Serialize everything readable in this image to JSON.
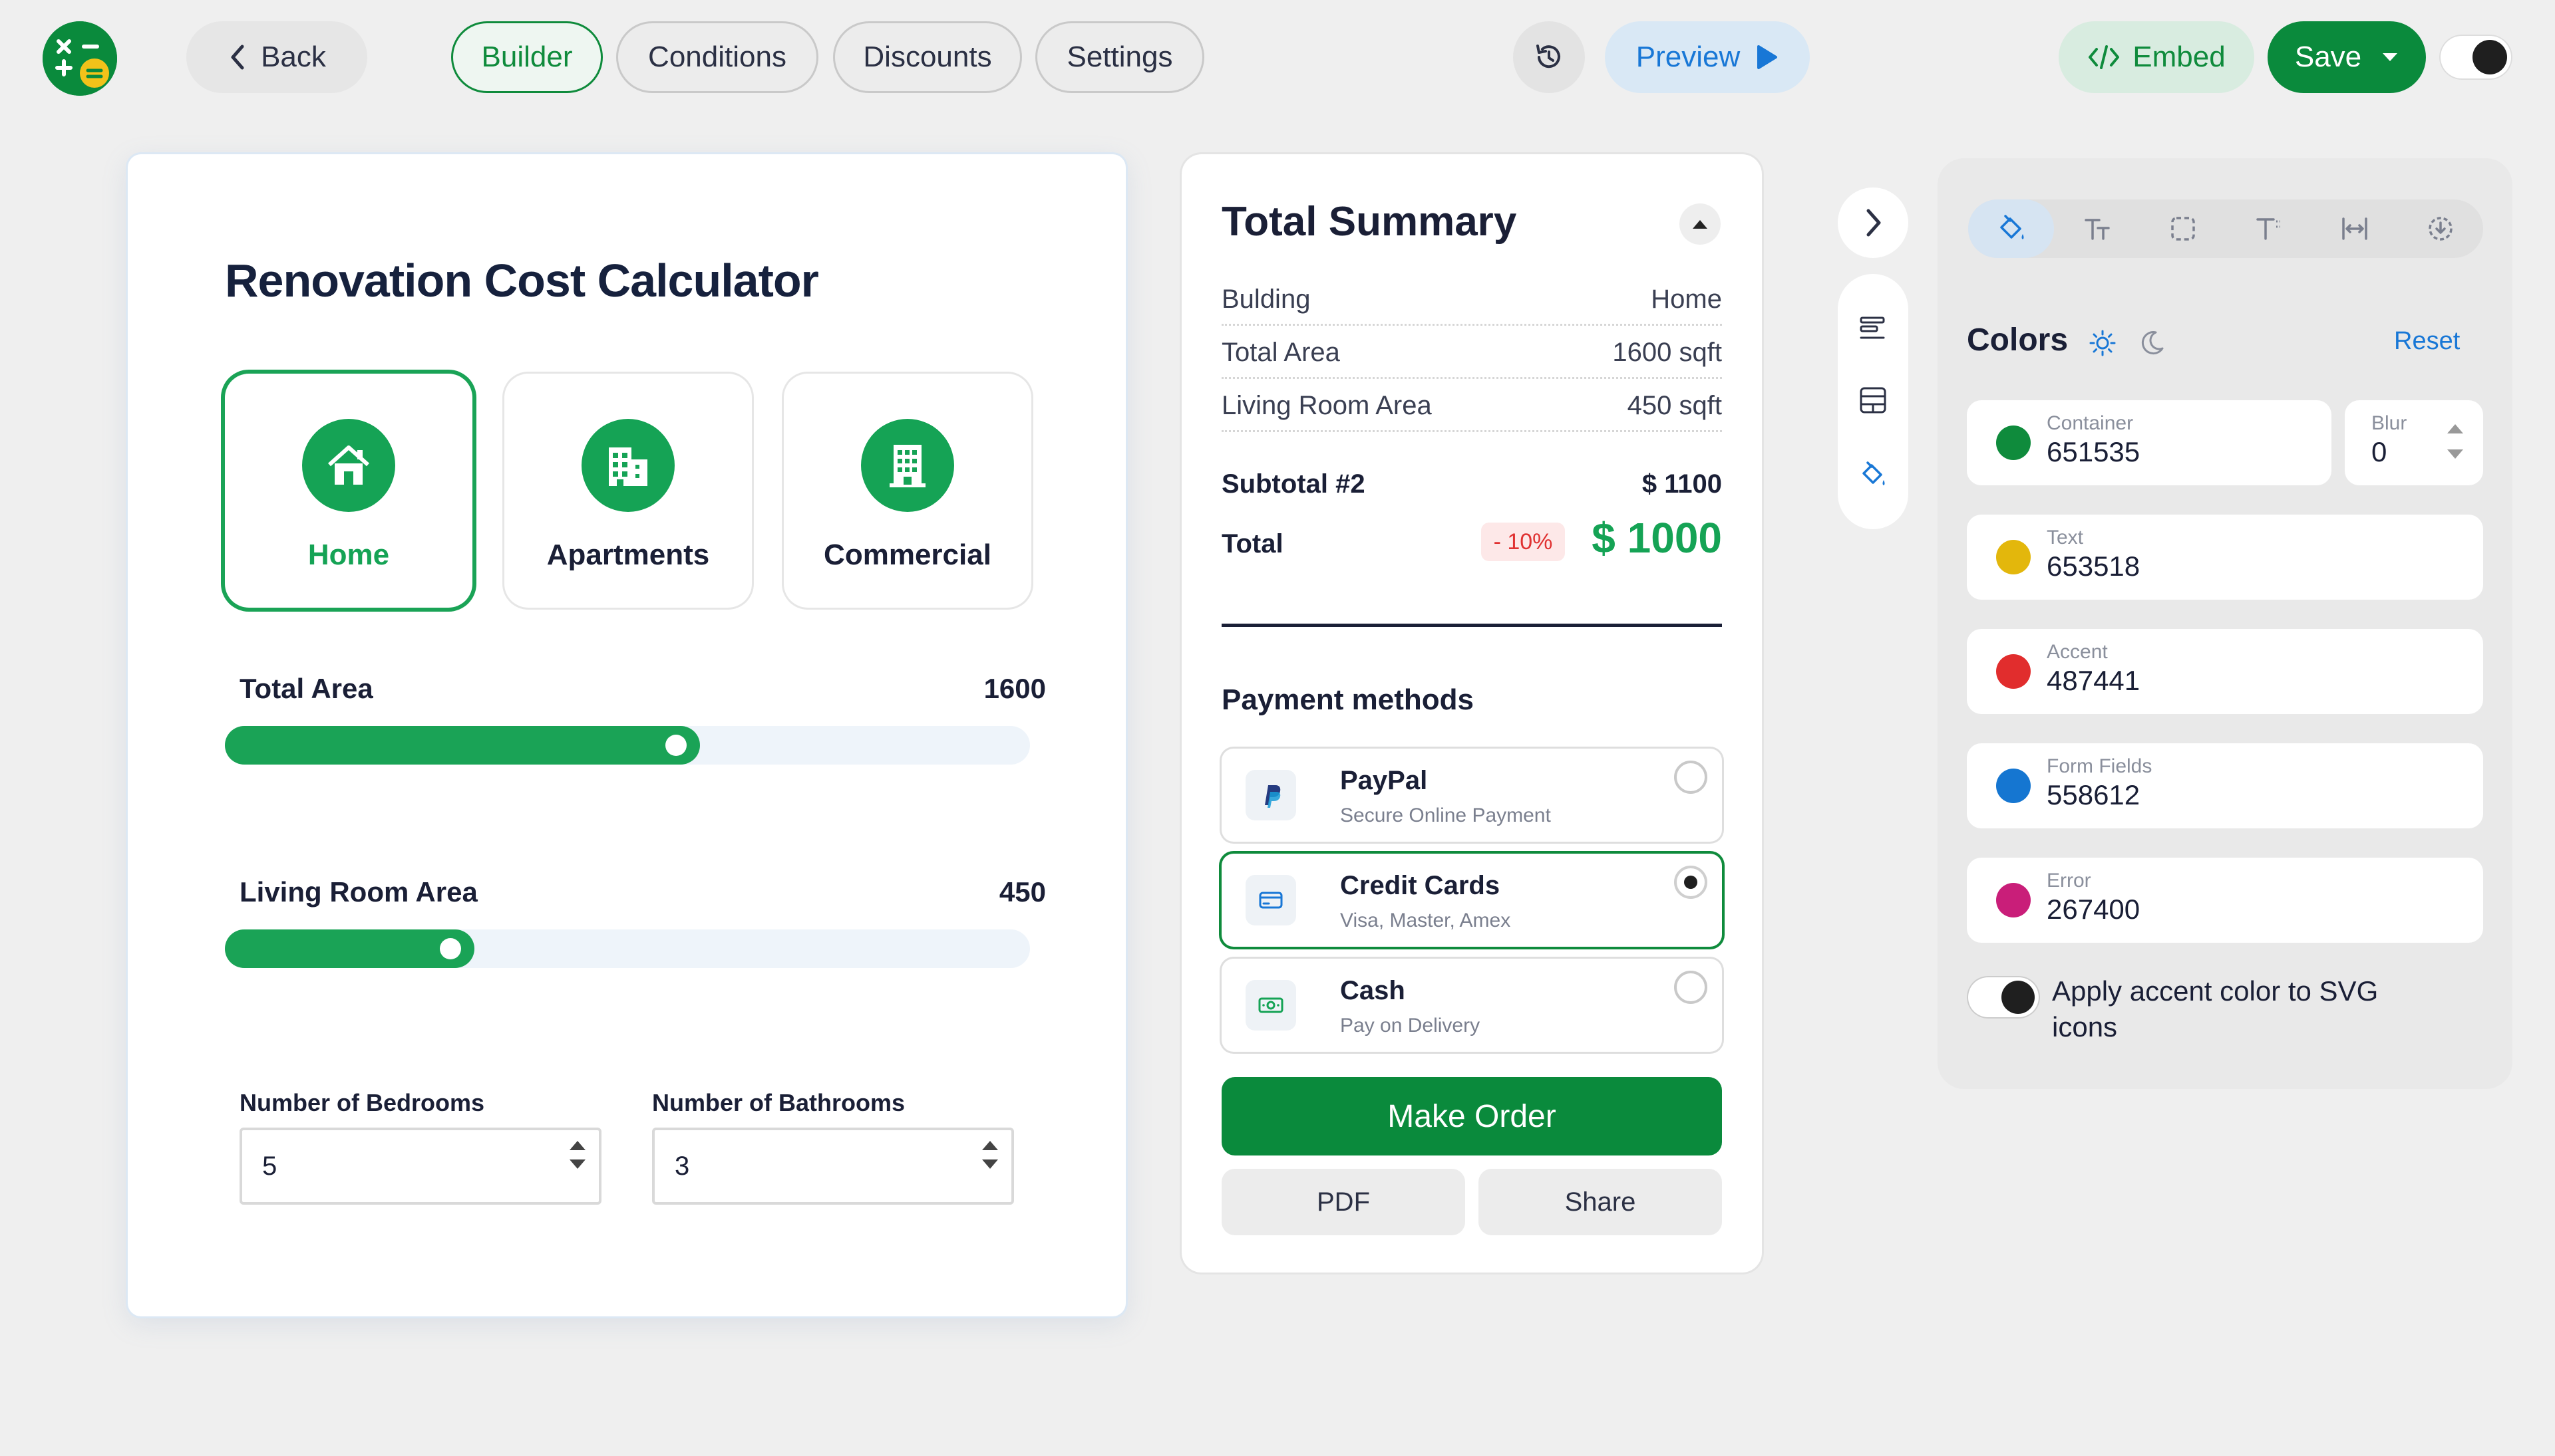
{
  "topbar": {
    "back_label": "Back",
    "tabs": [
      {
        "label": "Builder",
        "active": true
      },
      {
        "label": "Conditions",
        "active": false
      },
      {
        "label": "Discounts",
        "active": false
      },
      {
        "label": "Settings",
        "active": false
      }
    ],
    "preview_label": "Preview",
    "embed_label": "Embed",
    "save_label": "Save",
    "dark_mode": true
  },
  "calculator": {
    "title": "Renovation Cost Calculator",
    "building_types": [
      {
        "label": "Home",
        "icon": "home-icon",
        "selected": true
      },
      {
        "label": "Apartments",
        "icon": "apartments-icon",
        "selected": false
      },
      {
        "label": "Commercial",
        "icon": "commercial-icon",
        "selected": false
      }
    ],
    "sliders": [
      {
        "label": "Total Area",
        "value": "1600",
        "fill": 0.59
      },
      {
        "label": "Living Room Area",
        "value": "450",
        "fill": 0.31
      }
    ],
    "inputs": [
      {
        "label": "Number of Bedrooms",
        "value": "5"
      },
      {
        "label": "Number of Bathrooms",
        "value": "3"
      }
    ]
  },
  "summary": {
    "title": "Total Summary",
    "rows": [
      {
        "label": "Bulding",
        "value": "Home"
      },
      {
        "label": "Total Area",
        "value": "1600 sqft"
      },
      {
        "label": "Living Room Area",
        "value": "450 sqft"
      }
    ],
    "subtotal_label": "Subtotal #2",
    "subtotal_value": "$ 1100",
    "total_label": "Total",
    "discount": "- 10%",
    "total_value": "$ 1000",
    "payment_title": "Payment methods",
    "payment_methods": [
      {
        "name": "PayPal",
        "sub": "Secure Online Payment",
        "icon": "paypal-icon",
        "selected": false
      },
      {
        "name": "Credit Cards",
        "sub": "Visa, Master, Amex",
        "icon": "credit-card-icon",
        "selected": true
      },
      {
        "name": "Cash",
        "sub": "Pay on Delivery",
        "icon": "cash-icon",
        "selected": false
      }
    ],
    "order_label": "Make Order",
    "pdf_label": "PDF",
    "share_label": "Share"
  },
  "style_panel": {
    "section_title": "Colors",
    "reset_label": "Reset",
    "blur_label": "Blur",
    "blur_value": "0",
    "colors": [
      {
        "label": "Container",
        "value": "651535",
        "swatch": "#0f8b3c"
      },
      {
        "label": "Text",
        "value": "653518",
        "swatch": "#e3b70c"
      },
      {
        "label": "Accent",
        "value": "487441",
        "swatch": "#e12d2d"
      },
      {
        "label": "Form Fields",
        "value": "558612",
        "swatch": "#1576d1"
      },
      {
        "label": "Error",
        "value": "267400",
        "swatch": "#c91e79"
      }
    ],
    "svg_toggle_label": "Apply accent color to SVG icons"
  },
  "colors": {
    "primary_green": "#0a8a3c",
    "accent_green": "#15a355",
    "link_blue": "#1877d6"
  }
}
